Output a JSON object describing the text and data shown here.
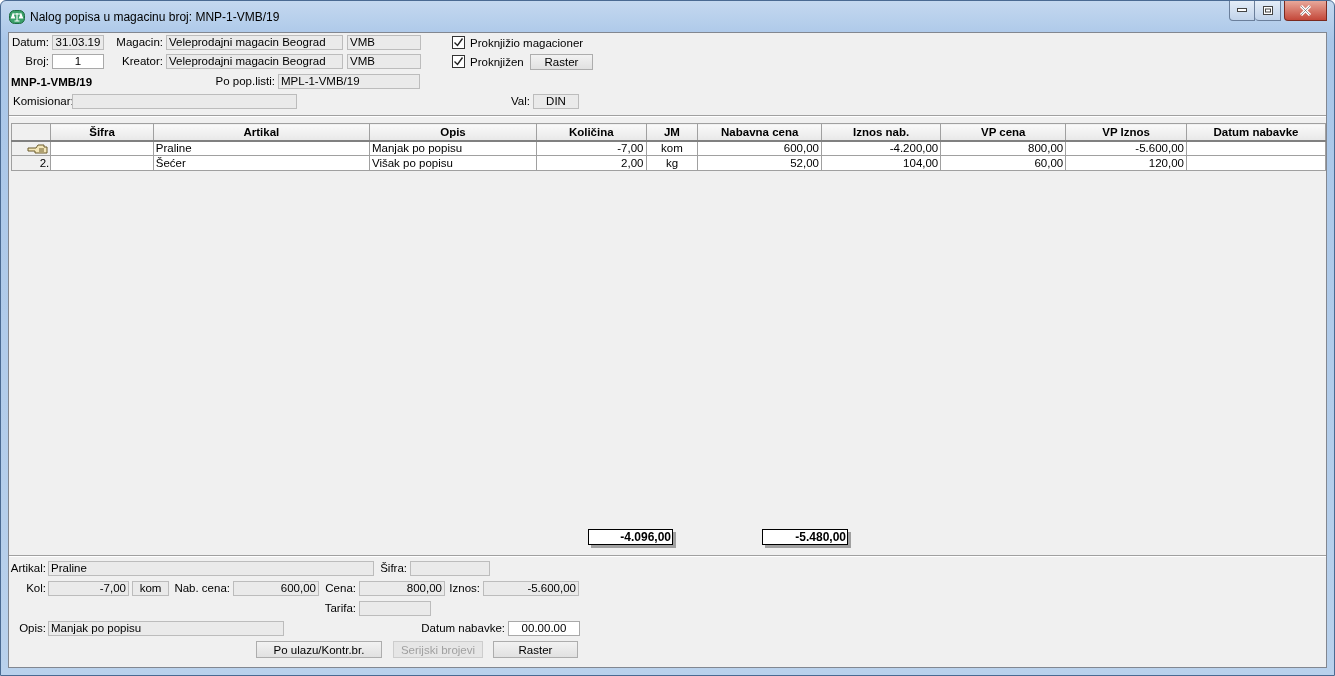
{
  "window": {
    "title": "Nalog popisa u magacinu broj: MNP-1-VMB/19"
  },
  "header": {
    "datum": {
      "label": "Datum:",
      "value": "31.03.19",
      "editable": false
    },
    "broj": {
      "label": "Broj:",
      "value": "1",
      "editable": true
    },
    "magacin": {
      "label": "Magacin:",
      "value": "Veleprodajni magacin Beograd",
      "code": "VMB"
    },
    "kreator": {
      "label": "Kreator:",
      "value": "Veleprodajni magacin Beograd",
      "code": "VMB"
    },
    "document_number": "MNP-1-VMB/19",
    "po_pop_listi": {
      "label": "Po pop.listi:",
      "value": "MPL-1-VMB/19"
    },
    "komisionar": {
      "label": "Komisionar:"
    },
    "val": {
      "label": "Val:",
      "value": "DIN"
    },
    "checks": [
      {
        "label": "Proknjižio magacioner",
        "checked": true
      },
      {
        "label": "Proknjižen",
        "checked": true
      }
    ],
    "raster_button": "Raster"
  },
  "table": {
    "columns": [
      {
        "label": "Šifra"
      },
      {
        "label": "Artikal"
      },
      {
        "label": "Opis"
      },
      {
        "label": "Količina"
      },
      {
        "label": "JM"
      },
      {
        "label": "Nabavna cena"
      },
      {
        "label": "Iznos nab.",
        "total": "-4.096,00"
      },
      {
        "label": "VP cena"
      },
      {
        "label": "VP Iznos",
        "total": "-5.480,00"
      },
      {
        "label": "Datum nabavke"
      }
    ],
    "rows": [
      {
        "current": true,
        "cells": [
          null,
          "Praline",
          "Manjak po popisu",
          "-7,00",
          "kom",
          "600,00",
          "-4.200,00",
          "800,00",
          "-5.600,00",
          null
        ]
      },
      {
        "current": false,
        "marker": "2.",
        "cells": [
          null,
          "Šećer",
          "Višak po popisu",
          "2,00",
          "kg",
          "52,00",
          "104,00",
          "60,00",
          "120,00",
          null
        ]
      }
    ]
  },
  "detail": {
    "artikal": {
      "label": "Artikal:",
      "value": "Praline"
    },
    "sifra": {
      "label": "Šifra:"
    },
    "kol": {
      "label": "Kol:",
      "value": "-7,00",
      "unit": "kom"
    },
    "nab_cena": {
      "label": "Nab. cena:",
      "value": "600,00"
    },
    "cena": {
      "label": "Cena:",
      "value": "800,00"
    },
    "iznos": {
      "label": "Iznos:",
      "value": "-5.600,00"
    },
    "tarifa": {
      "label": "Tarifa:"
    },
    "opis": {
      "label": "Opis:",
      "value": "Manjak po popisu"
    },
    "datum_nabavke": {
      "label": "Datum nabavke:",
      "value": "00.00.00",
      "editable": true
    },
    "buttons": [
      {
        "label": "Po ulazu/Kontr.br.",
        "disabled": false
      },
      {
        "label": "Serijski brojevi",
        "disabled": true
      },
      {
        "label": "Raster",
        "disabled": false
      }
    ]
  }
}
